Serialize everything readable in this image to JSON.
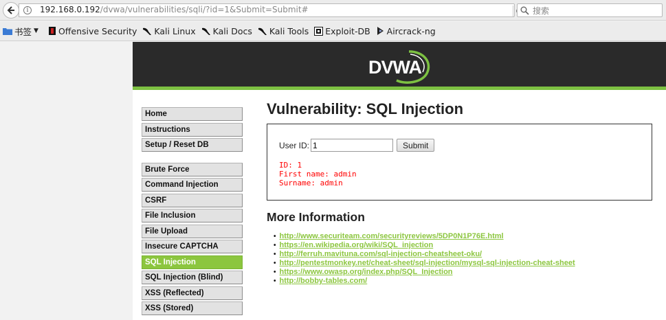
{
  "browser": {
    "url_host": "192.168.0.192",
    "url_path": "/dvwa/vulnerabilities/sqli/?id=1&Submit=Submit#",
    "search_placeholder": "搜索",
    "bookmarks_folder": "书签",
    "bookmarks": [
      "Offensive Security",
      "Kali Linux",
      "Kali Docs",
      "Kali Tools",
      "Exploit-DB",
      "Aircrack-ng"
    ]
  },
  "logo_text": "DVWA",
  "menu": {
    "group1": [
      "Home",
      "Instructions",
      "Setup / Reset DB"
    ],
    "group2": [
      "Brute Force",
      "Command Injection",
      "CSRF",
      "File Inclusion",
      "File Upload",
      "Insecure CAPTCHA",
      "SQL Injection",
      "SQL Injection (Blind)",
      "XSS (Reflected)",
      "XSS (Stored)"
    ],
    "active": "SQL Injection"
  },
  "main": {
    "title": "Vulnerability: SQL Injection",
    "user_id_label": "User ID:",
    "user_id_value": "1",
    "submit_label": "Submit",
    "result": [
      "ID: 1",
      "First name: admin",
      "Surname: admin"
    ],
    "more_info_title": "More Information",
    "links": [
      "http://www.securiteam.com/securityreviews/5DP0N1P76E.html",
      "https://en.wikipedia.org/wiki/SQL_injection",
      "http://ferruh.mavituna.com/sql-injection-cheatsheet-oku/",
      "http://pentestmonkey.net/cheat-sheet/sql-injection/mysql-sql-injection-cheat-sheet",
      "https://www.owasp.org/index.php/SQL_Injection",
      "http://bobby-tables.com/"
    ]
  },
  "colors": {
    "accent": "#8cc63f",
    "header_bg": "#2a2a2a",
    "result": "#ff0000"
  }
}
